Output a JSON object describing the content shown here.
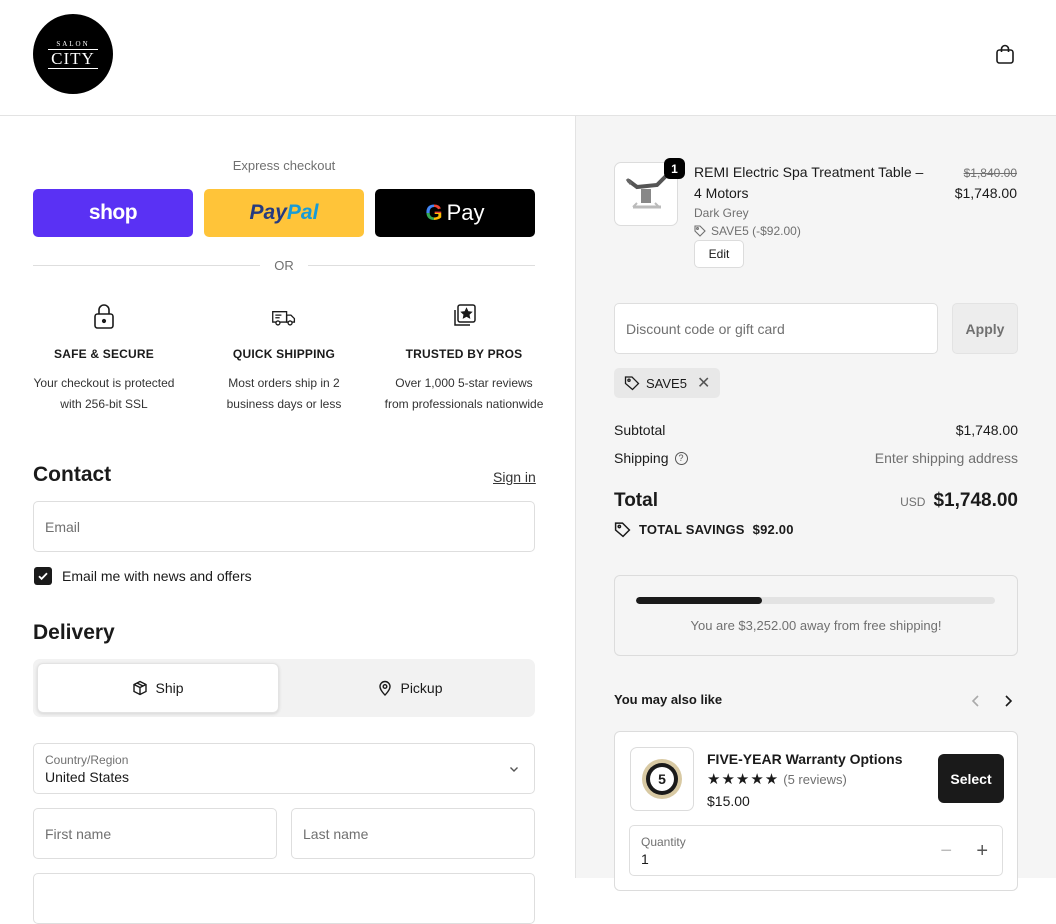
{
  "header": {
    "logo_small": "SALON",
    "logo_big": "CITY",
    "cart_icon": "shopping-bag-icon"
  },
  "express": {
    "title": "Express checkout",
    "shop_label": "shop",
    "paypal_1": "Pay",
    "paypal_2": "Pal",
    "gpay_g": "G",
    "gpay_label": "Pay",
    "or_label": "OR"
  },
  "features": [
    {
      "icon": "lock-icon",
      "title": "SAFE & SECURE",
      "desc": "Your checkout is protected with 256-bit SSL"
    },
    {
      "icon": "truck-icon",
      "title": "QUICK SHIPPING",
      "desc": "Most orders ship in 2 business days or less"
    },
    {
      "icon": "star-review-icon",
      "title": "TRUSTED BY PROS",
      "desc": "Over 1,000 5-star reviews from professionals nationwide"
    }
  ],
  "contact": {
    "title": "Contact",
    "signin": "Sign in",
    "email_placeholder": "Email",
    "newsletter_label": "Email me with news and offers",
    "newsletter_checked": true
  },
  "delivery": {
    "title": "Delivery",
    "ship_label": "Ship",
    "pickup_label": "Pickup",
    "selected": "Ship",
    "country_label": "Country/Region",
    "country_value": "United States",
    "first_name_placeholder": "First name",
    "last_name_placeholder": "Last name"
  },
  "cart": {
    "item": {
      "quantity": "1",
      "name": "REMI Electric Spa Treatment Table – 4 Motors",
      "variant": "Dark Grey",
      "discount": "SAVE5 (-$92.00)",
      "edit_label": "Edit",
      "price_original": "$1,840.00",
      "price_final": "$1,748.00"
    },
    "discount_placeholder": "Discount code or gift card",
    "apply_label": "Apply",
    "applied_code": "SAVE5",
    "subtotal_label": "Subtotal",
    "subtotal_value": "$1,748.00",
    "shipping_label": "Shipping",
    "shipping_value": "Enter shipping address",
    "total_label": "Total",
    "currency": "USD",
    "total_value": "$1,748.00",
    "savings_label": "TOTAL SAVINGS",
    "savings_value": "$92.00",
    "free_shipping_progress": 0.35,
    "free_shipping_text": "You are $3,252.00 away from free shipping!"
  },
  "recommendations": {
    "title": "You may also like",
    "item": {
      "name": "FIVE-YEAR Warranty Options",
      "stars": "★★★★★",
      "rating": 5,
      "reviews": "(5 reviews)",
      "price": "$15.00",
      "select_label": "Select",
      "badge_text": "5",
      "quantity_label": "Quantity",
      "quantity_value": "1",
      "minus": "−",
      "plus": "+"
    }
  },
  "colors": {
    "shop_pay": "#5a31f4",
    "paypal": "#ffc439",
    "gpay": "#000000",
    "accent_dark": "#1a1a1a"
  }
}
